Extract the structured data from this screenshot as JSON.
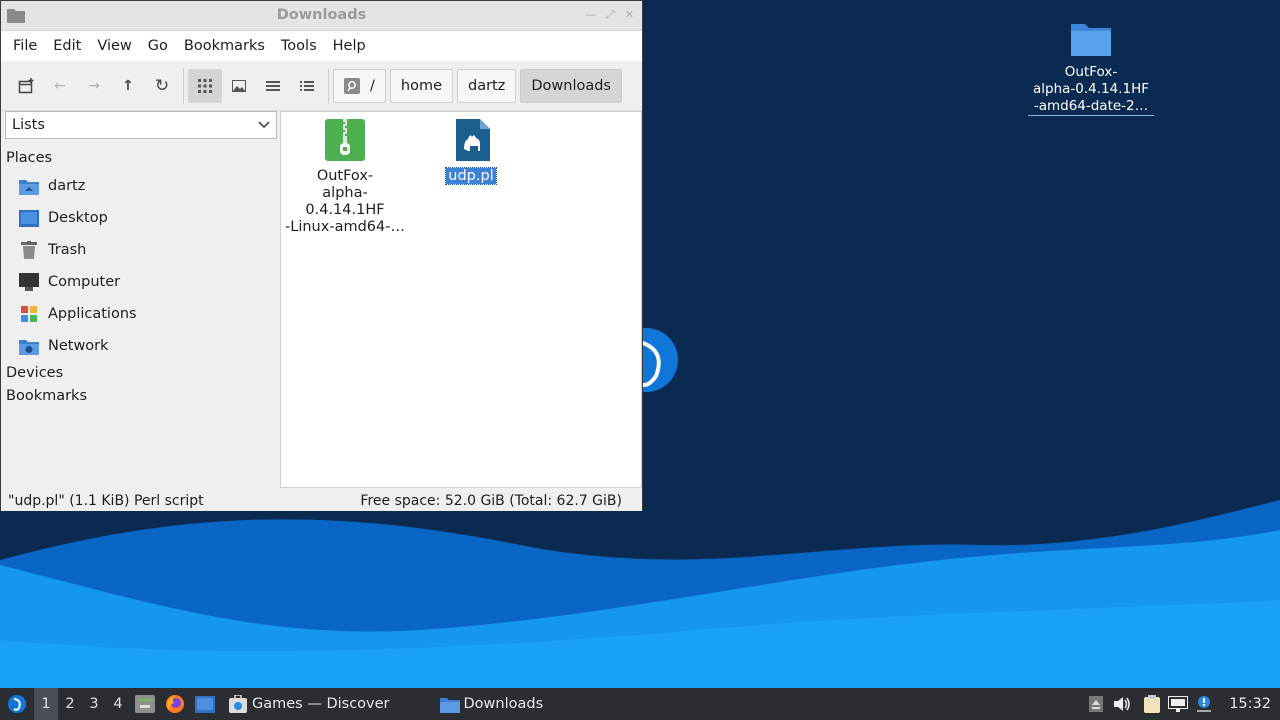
{
  "window": {
    "title": "Downloads",
    "menu": [
      "File",
      "Edit",
      "View",
      "Go",
      "Bookmarks",
      "Tools",
      "Help"
    ],
    "breadcrumb": [
      "/",
      "home",
      "dartz",
      "Downloads"
    ],
    "sidebar": {
      "selector": "Lists",
      "places_heading": "Places",
      "places": [
        {
          "label": "dartz",
          "icon": "home-folder-icon"
        },
        {
          "label": "Desktop",
          "icon": "desktop-icon"
        },
        {
          "label": "Trash",
          "icon": "trash-icon"
        },
        {
          "label": "Computer",
          "icon": "computer-icon"
        },
        {
          "label": "Applications",
          "icon": "applications-icon"
        },
        {
          "label": "Network",
          "icon": "network-icon"
        }
      ],
      "devices_heading": "Devices",
      "bookmarks_heading": "Bookmarks"
    },
    "files": [
      {
        "label": "OutFox-alpha-0.4.14.1HF-Linux-amd64-…",
        "lines": [
          "OutFox-",
          "alpha-0.4.14.1HF",
          "-Linux-amd64-…"
        ],
        "icon": "archive-icon",
        "selected": false
      },
      {
        "label": "udp.pl",
        "icon": "perl-script-icon",
        "selected": true
      }
    ],
    "status_left": "\"udp.pl\" (1.1 KiB) Perl script",
    "status_right": "Free space: 52.0 GiB (Total: 62.7 GiB)"
  },
  "desktop_icon": {
    "lines": [
      "OutFox-",
      "alpha-0.4.14.1HF",
      "-amd64-date-2…"
    ],
    "icon": "folder-icon"
  },
  "taskbar": {
    "workspaces": [
      "1",
      "2",
      "3",
      "4"
    ],
    "active_workspace": "1",
    "tasks": [
      {
        "label": "Games — Discover",
        "icon": "discover-icon"
      },
      {
        "label": "Downloads",
        "icon": "folder-icon"
      }
    ],
    "clock": "15:32"
  },
  "colors": {
    "selection": "#3c82d6",
    "taskbar": "#2a2e33",
    "desktop_dark": "#0b2a52",
    "wave_light": "#1597ef"
  }
}
